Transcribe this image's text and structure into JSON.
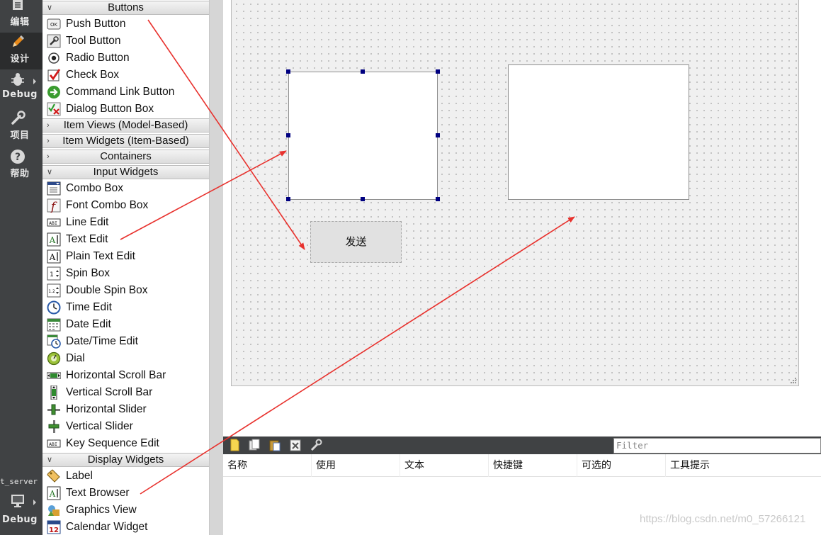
{
  "mode_bar": {
    "modes": [
      {
        "label": "编辑",
        "icon": "edit-mode-icon"
      },
      {
        "label": "设计",
        "icon": "design-mode-icon"
      },
      {
        "label": "Debug",
        "icon": "debug-mode-icon"
      },
      {
        "label": "项目",
        "icon": "project-mode-icon"
      },
      {
        "label": "帮助",
        "icon": "help-mode-icon"
      }
    ],
    "project_label": "t_server",
    "kit_label": "Debug"
  },
  "widget_box": {
    "categories": {
      "buttons": "Buttons",
      "item_views": "Item Views (Model-Based)",
      "item_widgets": "Item Widgets (Item-Based)",
      "containers": "Containers",
      "input_widgets": "Input Widgets",
      "display_widgets": "Display Widgets"
    },
    "buttons": [
      "Push Button",
      "Tool Button",
      "Radio Button",
      "Check Box",
      "Command Link Button",
      "Dialog Button Box"
    ],
    "input_widgets": [
      "Combo Box",
      "Font Combo Box",
      "Line Edit",
      "Text Edit",
      "Plain Text Edit",
      "Spin Box",
      "Double Spin Box",
      "Time Edit",
      "Date Edit",
      "Date/Time Edit",
      "Dial",
      "Horizontal Scroll Bar",
      "Vertical Scroll Bar",
      "Horizontal Slider",
      "Vertical Slider",
      "Key Sequence Edit"
    ],
    "display_widgets": [
      "Label",
      "Text Browser",
      "Graphics View",
      "Calendar Widget"
    ]
  },
  "form": {
    "send_button_label": "发送"
  },
  "action_editor": {
    "filter_placeholder": "Filter",
    "columns": [
      "名称",
      "使用",
      "文本",
      "快捷键",
      "可选的",
      "工具提示"
    ]
  },
  "watermark": "https://blog.csdn.net/m0_57266121",
  "colors": {
    "mode_bar": "#404244",
    "selection_handle": "#000080",
    "annotation_arrow": "#e8322e"
  }
}
